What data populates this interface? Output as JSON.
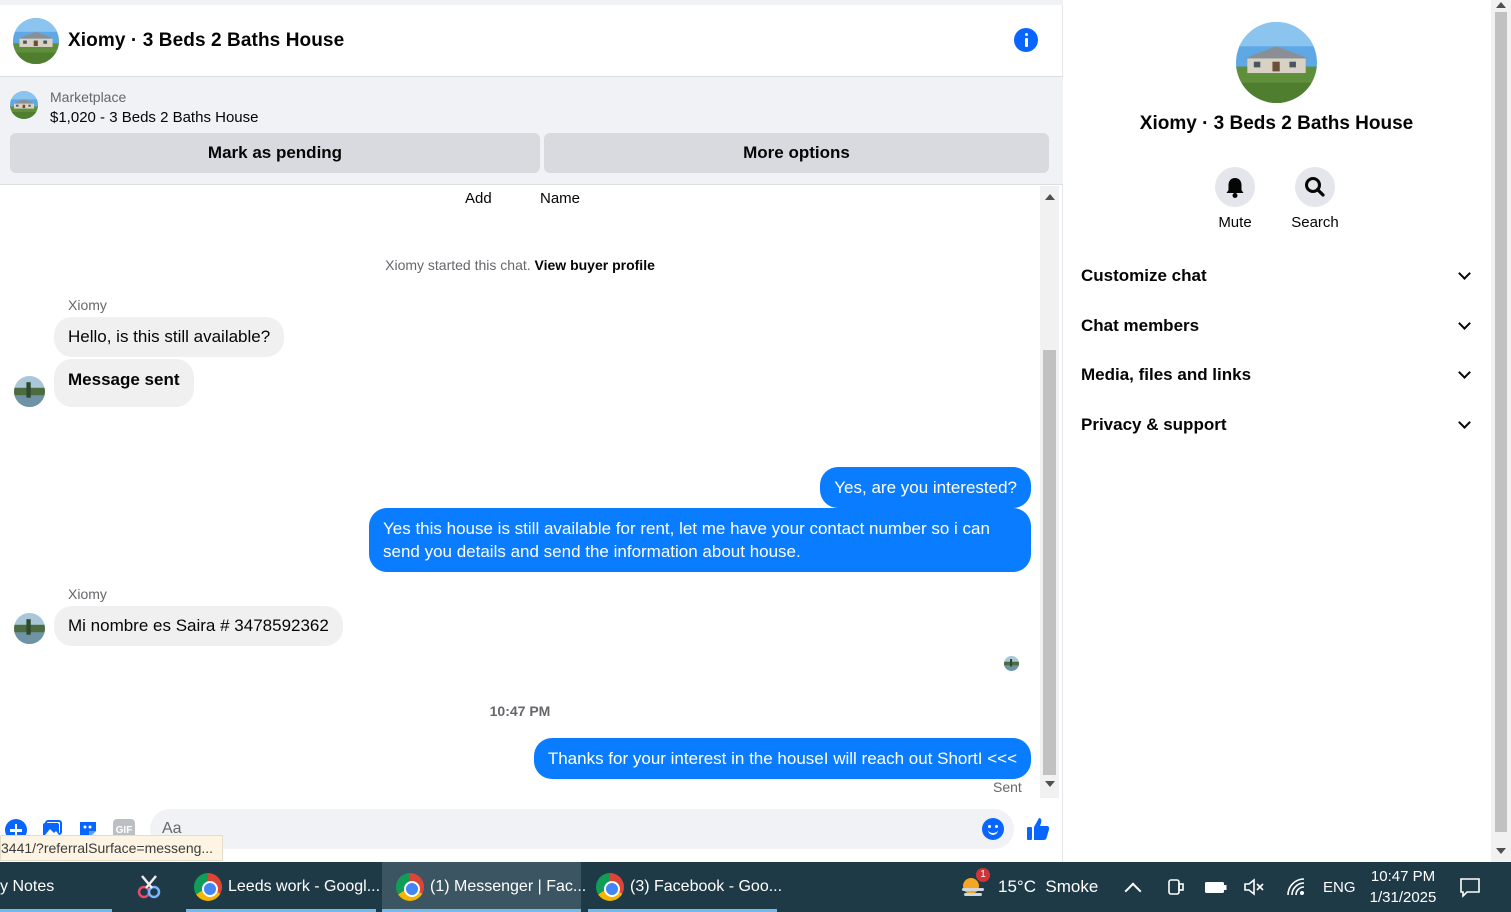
{
  "header": {
    "title": "Xiomy · 3 Beds 2 Baths House"
  },
  "marketplace": {
    "label": "Marketplace",
    "listing": "$1,020 - 3 Beds 2 Baths House",
    "pending_button": "Mark as pending",
    "more_button": "More options"
  },
  "messages": {
    "top_actions": [
      "Add",
      "Name"
    ],
    "system_text": "Xiomy started this chat.",
    "system_link": "View buyer profile",
    "sender": "Xiomy",
    "in_1": "Hello, is this still available?",
    "in_2": "Message sent",
    "out_1": "Yes, are you interested?",
    "out_2": "Yes this house is still available for rent, let me have your contact number so i can send you details and send the information about house.",
    "in_3": "Mi nombre es Saira # 3478592362",
    "time": "10:47 PM",
    "out_3": "Thanks for your interest in the houseI will reach out ShortI <<<",
    "status": "Sent"
  },
  "composer": {
    "placeholder": "Aa",
    "gif_label": "GIF"
  },
  "status_url": "3441/?referralSurface=messeng...",
  "panel": {
    "title": "Xiomy · 3 Beds 2 Baths House",
    "mute_label": "Mute",
    "search_label": "Search",
    "sections": [
      "Customize chat",
      "Chat members",
      "Media, files and links",
      "Privacy & support"
    ]
  },
  "taskbar": {
    "notes": "y Notes",
    "tab_1": "Leeds work - Googl...",
    "tab_2": "(1) Messenger | Fac...",
    "tab_3": "(3) Facebook - Goo...",
    "weather": "15°C  Smoke",
    "weather_badge": "1",
    "lang": "ENG",
    "time": "10:47 PM",
    "date": "1/31/2025"
  },
  "colors": {
    "accent": "#0866ff",
    "bubble_out": "#0a7cff",
    "bubble_in": "#f0f0f0",
    "taskbar": "#1f3a47"
  }
}
